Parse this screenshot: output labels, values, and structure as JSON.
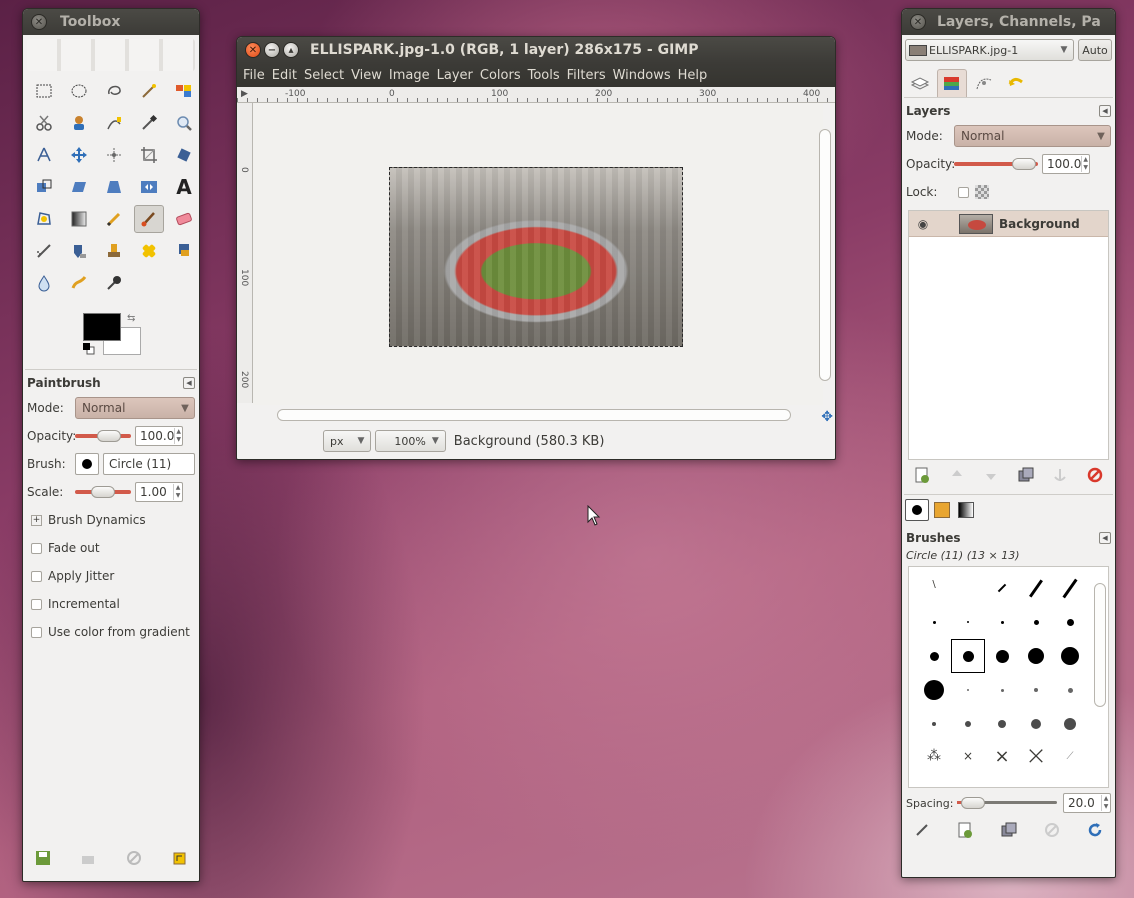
{
  "toolbox": {
    "title": "Toolbox",
    "tools": [
      "rect-select-icon",
      "ellipse-select-icon",
      "free-select-icon",
      "fuzzy-select-icon",
      "select-by-color-icon",
      "scissors-select-icon",
      "foreground-select-icon",
      "paths-icon",
      "color-picker-icon",
      "zoom-icon",
      "measure-icon",
      "move-icon",
      "align-icon",
      "crop-icon",
      "rotate-icon",
      "scale-icon",
      "shear-icon",
      "perspective-icon",
      "flip-icon",
      "text-icon",
      "cage-icon",
      "blend-icon",
      "pencil-icon",
      "paintbrush-icon",
      "eraser-icon",
      "airbrush-icon",
      "ink-icon",
      "clone-icon",
      "heal-icon",
      "perspective-clone-icon",
      "blur-icon",
      "smudge-icon",
      "dodge-burn-icon"
    ],
    "active_tool": "paintbrush-icon",
    "fg_color": "#000000",
    "bg_color": "#ffffff",
    "options_title": "Paintbrush",
    "mode_label": "Mode:",
    "mode_value": "Normal",
    "opacity_label": "Opacity:",
    "opacity_value": "100.0",
    "brush_label": "Brush:",
    "brush_value": "Circle (11)",
    "scale_label": "Scale:",
    "scale_value": "1.00",
    "dynamics_label": "Brush Dynamics",
    "checkboxes": [
      "Fade out",
      "Apply Jitter",
      "Incremental",
      "Use color from gradient"
    ]
  },
  "image_window": {
    "title": "ELLISPARK.jpg-1.0 (RGB, 1 layer) 286x175 - GIMP",
    "menu": [
      "File",
      "Edit",
      "Select",
      "View",
      "Image",
      "Layer",
      "Colors",
      "Tools",
      "Filters",
      "Windows",
      "Help"
    ],
    "ruler_h": [
      "-100",
      "0",
      "100",
      "200",
      "300",
      "400"
    ],
    "ruler_v": [
      "0",
      "100",
      "200"
    ],
    "unit": "px",
    "zoom": "100%",
    "status": "Background (580.3 KB)"
  },
  "layers_dock": {
    "title": "Layers, Channels, Pa",
    "image_combo": "ELLISPARK.jpg-1",
    "auto_label": "Auto",
    "layers_title": "Layers",
    "mode_label": "Mode:",
    "mode_value": "Normal",
    "opacity_label": "Opacity:",
    "opacity_value": "100.0",
    "lock_label": "Lock:",
    "layer_name": "Background",
    "brushes_title": "Brushes",
    "brush_info": "Circle (11) (13 × 13)",
    "spacing_label": "Spacing:",
    "spacing_value": "20.0"
  }
}
